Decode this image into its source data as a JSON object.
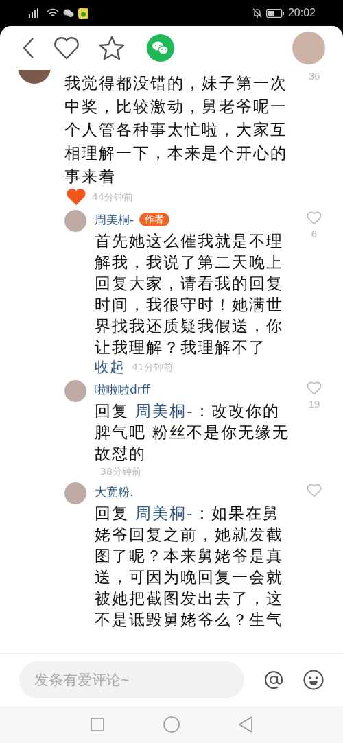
{
  "status_bar": {
    "time": "20:02"
  },
  "top_comment": {
    "text": "我觉得都没错的，妹子第一次中奖，比较激动，舅老爷呢一个人管各种事太忙啦，大家互相理解一下，本来是个开心的事来着",
    "time": "44分钟前",
    "likes": "36"
  },
  "replies": [
    {
      "name": "周美桐-",
      "badge": "作者",
      "text": "首先她这么催我就是不理解我，我说了第二天晚上回复大家，请看我的回复时间，我很守时！她满世界找我还质疑我假送，你让我理解？我理解不了",
      "toggle": "收起",
      "time": "41分钟前",
      "likes": "6"
    },
    {
      "name": "啦啦啦drff",
      "reply_label": "回复",
      "reply_to": "周美桐-",
      "text": "：改改你的脾气吧 粉丝不是你无缘无故怼的",
      "time": "38分钟前",
      "likes": "19"
    },
    {
      "name": "大宽粉.",
      "reply_label": "回复",
      "reply_to": "周美桐-",
      "text": "：如果在舅姥爷回复之前，她就发截图了呢？本来舅姥爷是真送，可因为晚回复一会就被她把截图发出去了，这不是诋毁舅姥爷么？生气"
    }
  ],
  "composer": {
    "placeholder": "发条有爱评论~"
  }
}
